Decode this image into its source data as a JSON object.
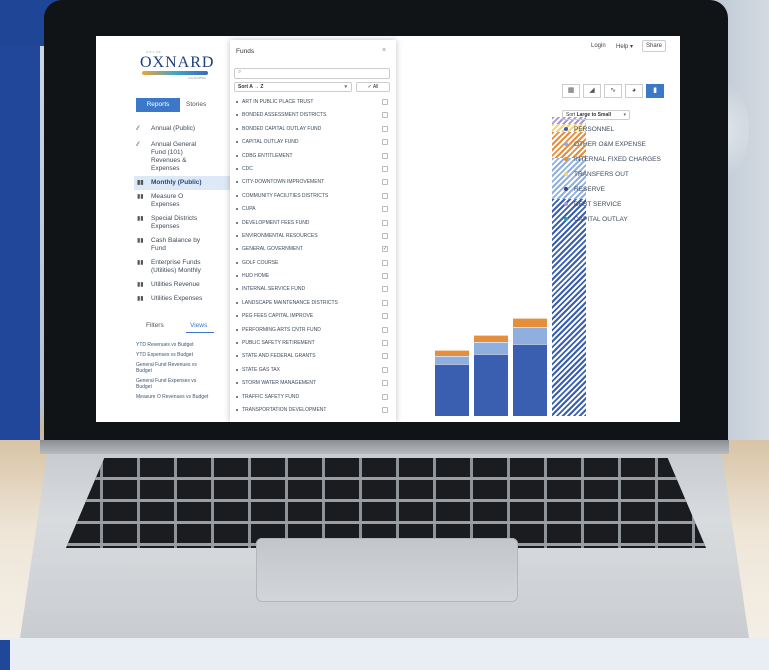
{
  "topbar": {
    "login": "Login",
    "help": "Help",
    "share": "Share"
  },
  "logo": {
    "top": "CITY OF",
    "word": "OXNARD",
    "bottom": "CALIFORNIA"
  },
  "tabs": {
    "reports": "Reports",
    "stories": "Stories"
  },
  "nav": {
    "items": [
      {
        "label": "Annual (Public)"
      },
      {
        "label": "Annual General\nFund (101)\nRevenues &\nExpenses"
      },
      {
        "label": "Monthly (Public)"
      },
      {
        "label": "Measure O\nExpenses"
      },
      {
        "label": "Special Districts\nExpenses"
      },
      {
        "label": "Cash Balance by\nFund"
      },
      {
        "label": "Enterprise Funds\n(Utilities) Monthly"
      },
      {
        "label": "Utilities Revenue"
      },
      {
        "label": "Utilities Expenses"
      }
    ]
  },
  "subtabs": {
    "filters": "Filters",
    "views": "Views"
  },
  "views": {
    "items": [
      "YTD Revenues vs Budget",
      "YTD Expenses vs Budget",
      "General Fund Revenues vs\nBudget",
      "General Fund Expenses vs\nBudget",
      "Measure O Revenues vs Budget"
    ]
  },
  "funds": {
    "title": "Funds",
    "sort_value": "Sort A → Z",
    "all_label": "✓ All",
    "items": [
      {
        "name": "Art in Public Place Trust",
        "checked": ""
      },
      {
        "name": "Bonded Assessment Districts",
        "checked": ""
      },
      {
        "name": "Bonded Capital Outlay Fund",
        "checked": ""
      },
      {
        "name": "Capital Outlay Fund",
        "checked": ""
      },
      {
        "name": "CDBG Entitlement",
        "checked": ""
      },
      {
        "name": "CDC",
        "checked": ""
      },
      {
        "name": "City-Downtown Improvement",
        "checked": ""
      },
      {
        "name": "Community Facilities Districts",
        "checked": ""
      },
      {
        "name": "CUPA",
        "checked": ""
      },
      {
        "name": "Development Fees Fund",
        "checked": ""
      },
      {
        "name": "Environmental Resources",
        "checked": ""
      },
      {
        "name": "General Government",
        "checked": "✓"
      },
      {
        "name": "Golf Course",
        "checked": ""
      },
      {
        "name": "HUD Home",
        "checked": ""
      },
      {
        "name": "Internal Service Fund",
        "checked": ""
      },
      {
        "name": "Landscape Maintenance Districts",
        "checked": ""
      },
      {
        "name": "PEG Fees Capital Improve",
        "checked": ""
      },
      {
        "name": "Performing Arts CNTR Fund",
        "checked": ""
      },
      {
        "name": "Public Safety Retirement",
        "checked": ""
      },
      {
        "name": "State and Federal Grants",
        "checked": ""
      },
      {
        "name": "State Gas Tax",
        "checked": ""
      },
      {
        "name": "Storm Water Management",
        "checked": ""
      },
      {
        "name": "Traffic Safety Fund",
        "checked": ""
      },
      {
        "name": "Transportation Development",
        "checked": ""
      }
    ]
  },
  "chart_toolbar": {
    "buttons": [
      {
        "icon": "table-icon",
        "glyph": "▦"
      },
      {
        "icon": "area-chart-icon",
        "glyph": "◢"
      },
      {
        "icon": "line-chart-icon",
        "glyph": "∿"
      },
      {
        "icon": "pie-chart-icon",
        "glyph": "◕"
      },
      {
        "icon": "bar-chart-icon",
        "glyph": "▮",
        "active": true
      }
    ]
  },
  "sort_select": {
    "label": "Sort",
    "value": "Large to Small"
  },
  "legend": {
    "items": [
      {
        "label": "PERSONNEL",
        "color": "#3a5fb0"
      },
      {
        "label": "OTHER O&M EXPENSE",
        "color": "#8fb0de"
      },
      {
        "label": "INTERNAL FIXED CHARGES",
        "color": "#e58e3c"
      },
      {
        "label": "TRANSFERS OUT",
        "color": "#f3cf7a"
      },
      {
        "label": "RESERVE",
        "color": "#3a3f8f"
      },
      {
        "label": "DEBT SERVICE",
        "color": "#a796d6"
      },
      {
        "label": "CAPITAL OUTLAY",
        "color": "#27a79b"
      }
    ]
  },
  "chart_data": {
    "type": "bar",
    "stacked": true,
    "categories": [
      "",
      "",
      "",
      "",
      ""
    ],
    "series": [
      {
        "name": "PERSONNEL",
        "values": [
          0,
          50,
          60,
          70,
          210
        ]
      },
      {
        "name": "OTHER O&M EXPENSE",
        "values": [
          0,
          8,
          12,
          16,
          40
        ]
      },
      {
        "name": "INTERNAL FIXED CHARGES",
        "values": [
          0,
          6,
          6,
          9,
          25
        ]
      },
      {
        "name": "TRANSFERS OUT",
        "values": [
          0,
          0,
          0,
          0,
          8
        ]
      },
      {
        "name": "RESERVE",
        "values": [
          0,
          0,
          0,
          0,
          0
        ]
      },
      {
        "name": "DEBT SERVICE",
        "values": [
          0,
          0,
          0,
          0,
          6
        ]
      },
      {
        "name": "CAPITAL OUTLAY",
        "values": [
          0,
          0,
          0,
          0,
          0
        ]
      }
    ],
    "projected_last": true,
    "legend_position": "right",
    "grid": false
  }
}
